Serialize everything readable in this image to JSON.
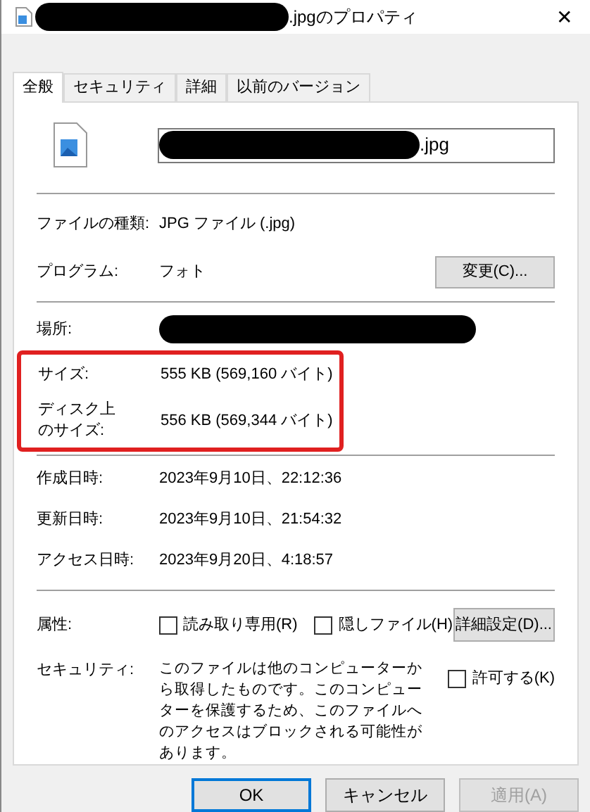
{
  "window": {
    "title_suffix": ".jpgのプロパティ",
    "title_redacted": true,
    "close": "✕"
  },
  "tabs": [
    {
      "label": "全般",
      "selected": true
    },
    {
      "label": "セキュリティ",
      "selected": false
    },
    {
      "label": "詳細",
      "selected": false
    },
    {
      "label": "以前のバージョン",
      "selected": false
    }
  ],
  "file_name": {
    "value": ".jpg",
    "redacted": true
  },
  "type_section": [
    {
      "label": "ファイルの種類:",
      "value": "JPG ファイル (.jpg)"
    },
    {
      "label": "プログラム:",
      "value": "フォト",
      "button": "変更(C)..."
    }
  ],
  "location": {
    "label": "場所:",
    "redacted": true
  },
  "size_section": {
    "highlighted": true,
    "rows": [
      {
        "label": "サイズ:",
        "value": "555 KB (569,160 バイト)"
      },
      {
        "label": "ディスク上のサイズ:",
        "value": "556 KB (569,344 バイト)"
      }
    ]
  },
  "dates": [
    {
      "label": "作成日時:",
      "value": "2023年9月10日、22:12:36"
    },
    {
      "label": "更新日時:",
      "value": "2023年9月10日、21:54:32"
    },
    {
      "label": "アクセス日時:",
      "value": "2023年9月20日、4:18:57"
    }
  ],
  "attributes": {
    "label": "属性:",
    "checkboxes": [
      {
        "label": "読み取り専用(R)",
        "checked": false
      },
      {
        "label": "隠しファイル(H)",
        "checked": false
      }
    ],
    "button": "詳細設定(D)..."
  },
  "security": {
    "label": "セキュリティ:",
    "text": "このファイルは他のコンピューターから取得したものです。このコンピューターを保護するため、このファイルへのアクセスはブロックされる可能性があります。",
    "checkbox": {
      "label": "許可する(K)",
      "checked": false
    }
  },
  "buttons": [
    {
      "label": "OK",
      "kind": "default",
      "disabled": false
    },
    {
      "label": "キャンセル",
      "kind": "normal",
      "disabled": false
    },
    {
      "label": "適用(A)",
      "kind": "normal",
      "disabled": true
    }
  ]
}
